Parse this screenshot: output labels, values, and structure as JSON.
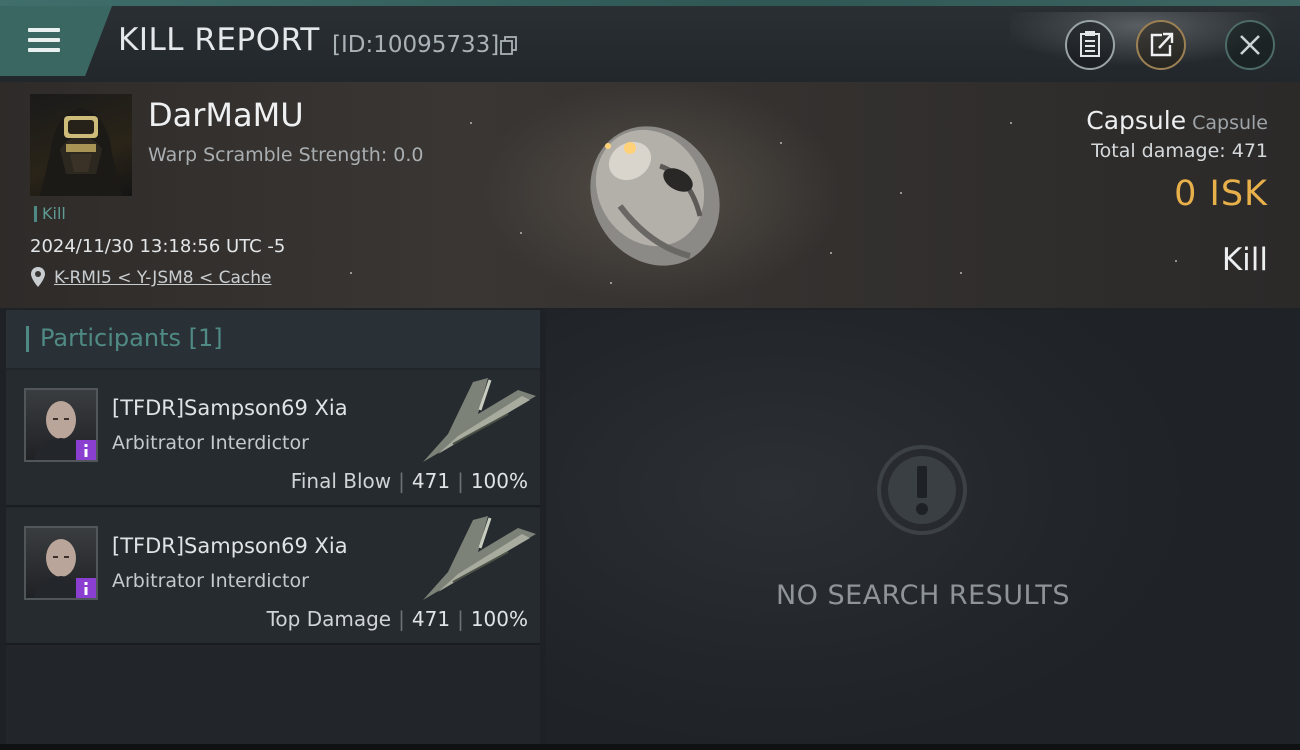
{
  "header": {
    "title": "KILL REPORT",
    "report_id": "[ID:10095733]",
    "icons": {
      "menu": "hamburger-menu-icon",
      "copy": "copy-icon",
      "clipboard": "clipboard-icon",
      "share": "share-icon",
      "close": "close-icon"
    }
  },
  "victim": {
    "name": "DarMaMU",
    "warp_scramble": "Warp Scramble Strength: 0.0",
    "tag": "Kill",
    "datetime": "2024/11/30 13:18:56 UTC -5",
    "location": "K-RMI5 < Y-JSM8 < Cache",
    "ship_name": "Capsule",
    "ship_type": "Capsule",
    "total_damage": "Total damage:  471",
    "isk": "0  ISK",
    "result": "Kill"
  },
  "participants": {
    "title": "Participants [1]",
    "rows": [
      {
        "name": "[TFDR]Sampson69 Xia",
        "ship": "Arbitrator Interdictor",
        "label": "Final Blow",
        "damage": "471",
        "percent": "100%"
      },
      {
        "name": "[TFDR]Sampson69 Xia",
        "ship": "Arbitrator Interdictor",
        "label": "Top Damage",
        "damage": "471",
        "percent": "100%"
      }
    ]
  },
  "results": {
    "empty_text": "NO SEARCH RESULTS"
  },
  "colors": {
    "accent_teal": "#4e8a83",
    "isk_gold": "#e8b04a",
    "badge_purple": "#8a3fd0"
  }
}
